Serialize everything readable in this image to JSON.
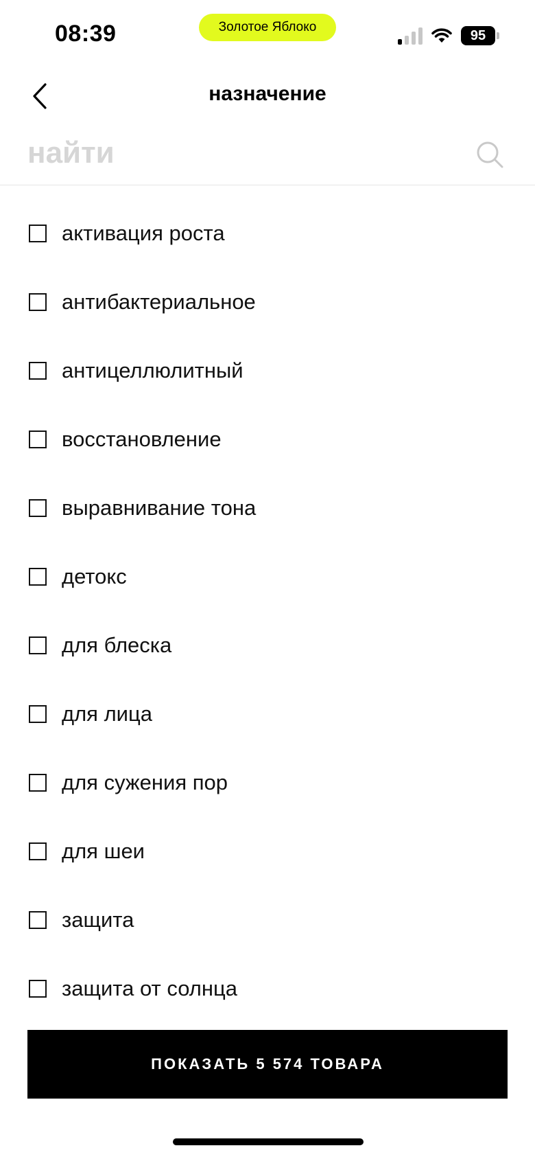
{
  "status_bar": {
    "time": "08:39",
    "island_label": "Золотое Яблоко",
    "battery_level": "95",
    "signal_icon": "cellular-signal-icon",
    "wifi_icon": "wifi-icon",
    "battery_icon": "battery-icon"
  },
  "header": {
    "title": "назначение",
    "back_icon": "chevron-left-icon"
  },
  "search": {
    "placeholder": "найти",
    "value": "",
    "icon": "search-icon"
  },
  "filters": {
    "items": [
      {
        "label": "активация роста",
        "checked": false
      },
      {
        "label": "антибактериальное",
        "checked": false
      },
      {
        "label": "антицеллюлитный",
        "checked": false
      },
      {
        "label": "восстановление",
        "checked": false
      },
      {
        "label": "выравнивание тона",
        "checked": false
      },
      {
        "label": "детокс",
        "checked": false
      },
      {
        "label": "для блеска",
        "checked": false
      },
      {
        "label": "для лица",
        "checked": false
      },
      {
        "label": "для сужения пор",
        "checked": false
      },
      {
        "label": "для шеи",
        "checked": false
      },
      {
        "label": "защита",
        "checked": false
      },
      {
        "label": "защита от солнца",
        "checked": false
      }
    ]
  },
  "footer": {
    "show_button_label": "ПОКАЗАТЬ 5 574 ТОВАРА"
  },
  "colors": {
    "island": "#e2fa1e",
    "button_bg": "#000000",
    "placeholder": "#d6d6d6"
  }
}
